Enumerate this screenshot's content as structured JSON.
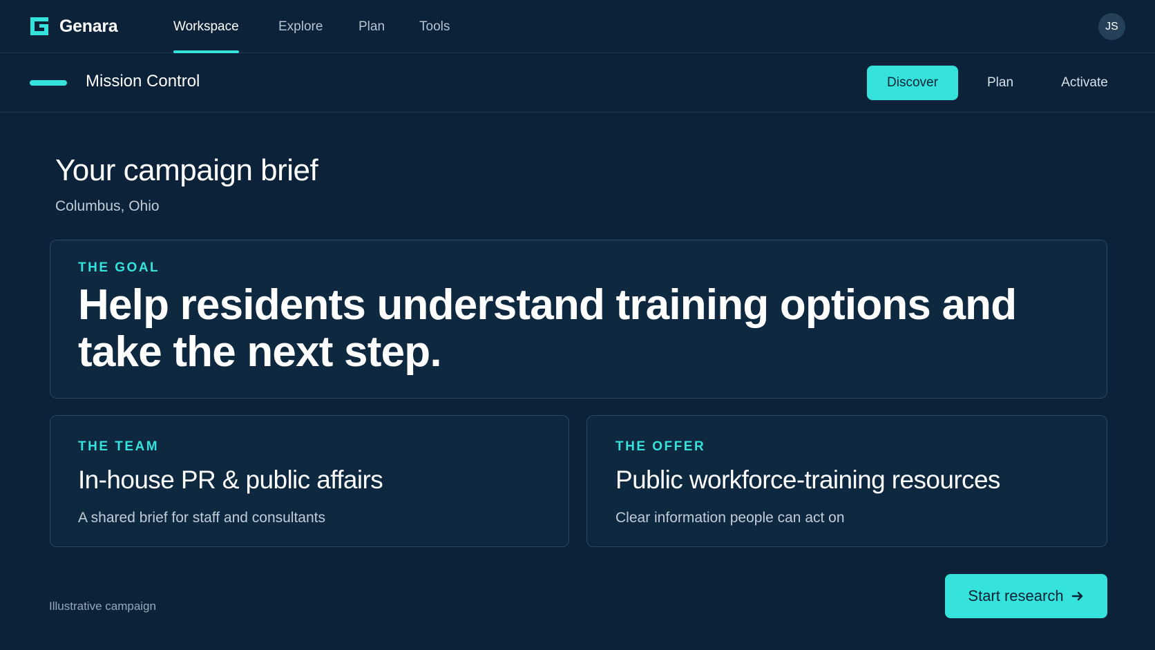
{
  "brand": {
    "name": "Genara"
  },
  "nav": {
    "tabs": [
      {
        "label": "Workspace",
        "active": true
      },
      {
        "label": "Explore",
        "active": false
      },
      {
        "label": "Plan",
        "active": false
      },
      {
        "label": "Tools",
        "active": false
      }
    ]
  },
  "user": {
    "initials": "JS"
  },
  "subbar": {
    "title": "Mission Control",
    "stages": [
      {
        "label": "Discover",
        "active": true
      },
      {
        "label": "Plan",
        "active": false
      },
      {
        "label": "Activate",
        "active": false
      }
    ]
  },
  "brief": {
    "title": "Your campaign brief",
    "location": "Columbus, Ohio",
    "goal": {
      "label": "THE GOAL",
      "text": "Help residents understand training options and take the next step."
    },
    "team": {
      "label": "THE TEAM",
      "heading": "In-house PR & public affairs",
      "description": "A shared brief for staff and consultants"
    },
    "offer": {
      "label": "THE OFFER",
      "heading": "Public workforce-training resources",
      "description": "Clear information people can act on"
    }
  },
  "footer": {
    "note": "Illustrative campaign",
    "cta_label": "Start research"
  },
  "icons": {
    "brand_logo": "g-logo-icon",
    "cta_arrow": "arrow-right-icon"
  },
  "colors": {
    "background": "#0b2239",
    "accent": "#35e3dc",
    "card_bg": "#0e2840",
    "border": "#2a4660"
  }
}
